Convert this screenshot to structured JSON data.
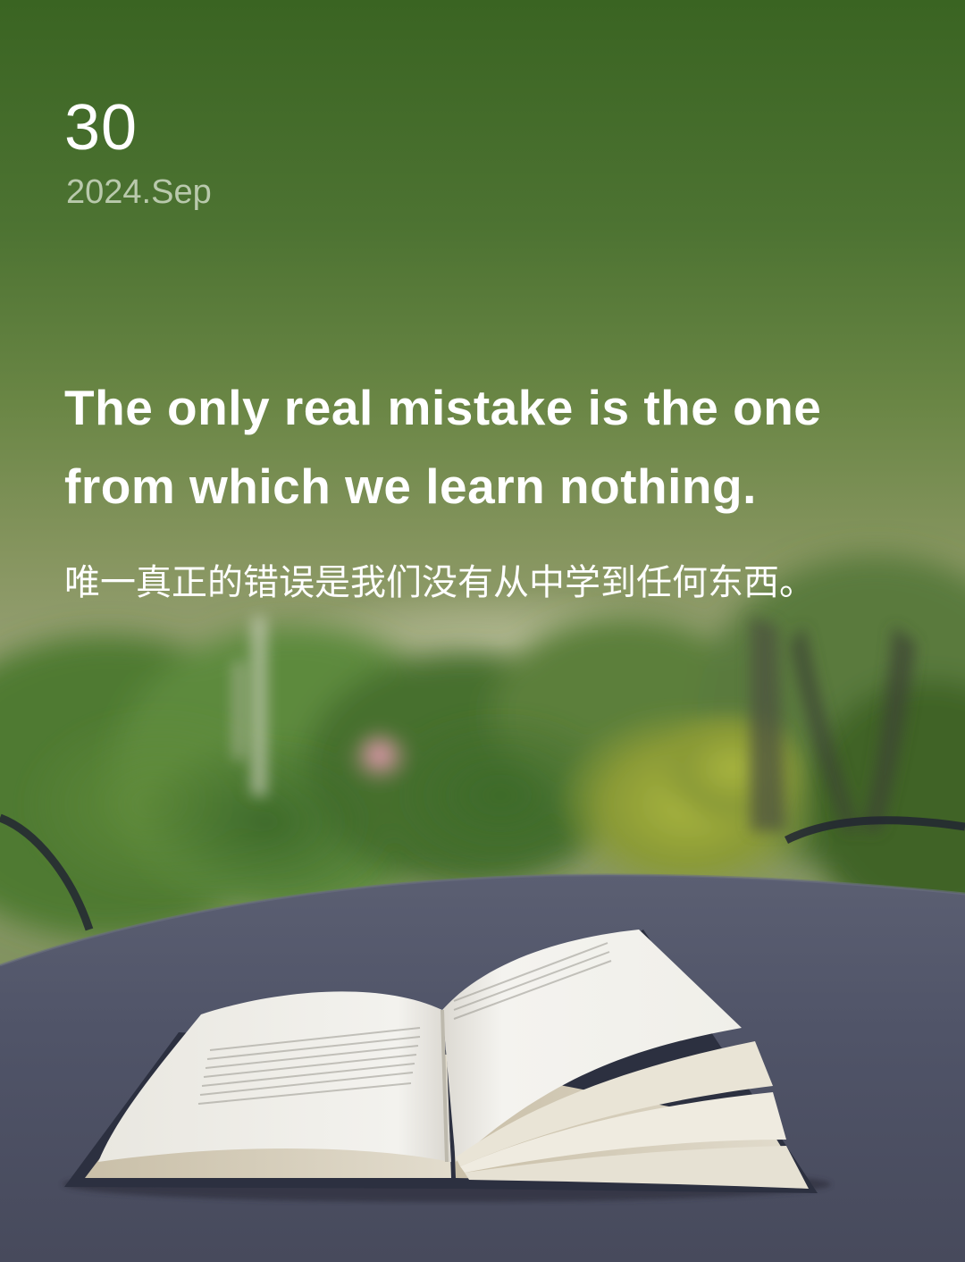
{
  "date": {
    "day": "30",
    "year_month": "2024.Sep"
  },
  "quote": {
    "english": "The only real mistake is the one from which we learn nothing.",
    "chinese": "唯一真正的错误是我们没有从中学到任何东西。"
  },
  "photo": {
    "subject": "open-book-on-garden-table",
    "colors": {
      "sky_top": "#3a6422",
      "sky_mid": "#8c9b68",
      "table": "#50546a",
      "page": "#efeee8"
    }
  }
}
